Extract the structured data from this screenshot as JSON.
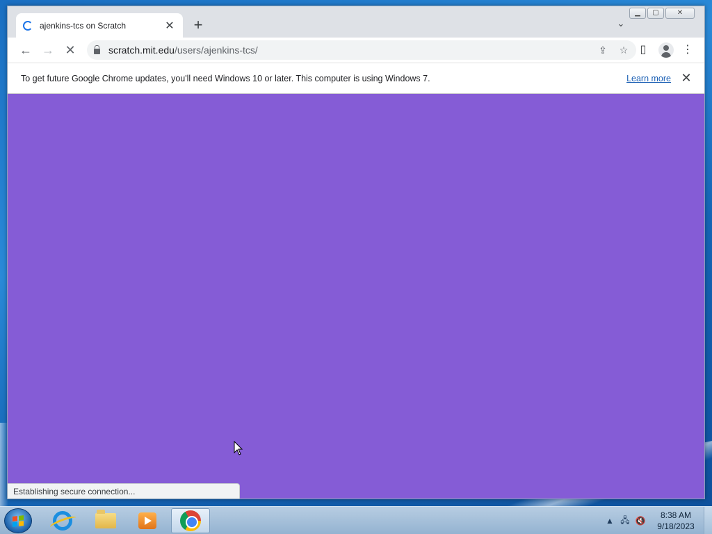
{
  "browser": {
    "tab": {
      "title": "ajenkins-tcs on Scratch",
      "close_glyph": "✕"
    },
    "new_tab_glyph": "+",
    "tab_search_glyph": "⌄",
    "window_controls": {
      "minimize": "▁",
      "maximize": "▢",
      "close": "✕"
    },
    "nav": {
      "back_glyph": "←",
      "forward_glyph": "→",
      "stop_glyph": "✕"
    },
    "url": {
      "host": "scratch.mit.edu",
      "path": "/users/ajenkins-tcs/"
    },
    "omnibox_icons": {
      "share_glyph": "⇪",
      "bookmark_glyph": "☆"
    },
    "toolbar_icons": {
      "sidepanel_glyph": "▯",
      "menu_glyph": "⋮"
    },
    "infobar": {
      "message": "To get future Google Chrome updates, you'll need Windows 10 or later. This computer is using Windows 7.",
      "link": "Learn more",
      "close_glyph": "✕"
    },
    "page_background": "#855cd6",
    "status": "Establishing secure connection..."
  },
  "taskbar": {
    "apps": [
      {
        "name": "Internet Explorer",
        "icon": "ie-icon"
      },
      {
        "name": "Windows Explorer",
        "icon": "folder-icon"
      },
      {
        "name": "Windows Media Player",
        "icon": "media-icon"
      },
      {
        "name": "Google Chrome",
        "icon": "chrome-icon",
        "active": true
      }
    ],
    "tray": {
      "overflow_glyph": "▲",
      "network_glyph": "🖧",
      "volume_glyph": "🔇"
    },
    "clock": {
      "time": "8:38 AM",
      "date": "9/18/2023"
    }
  },
  "colors": {
    "accent_blue": "#1a73e8",
    "scratch_purple": "#855cd6",
    "link_blue": "#1a5fb4"
  }
}
